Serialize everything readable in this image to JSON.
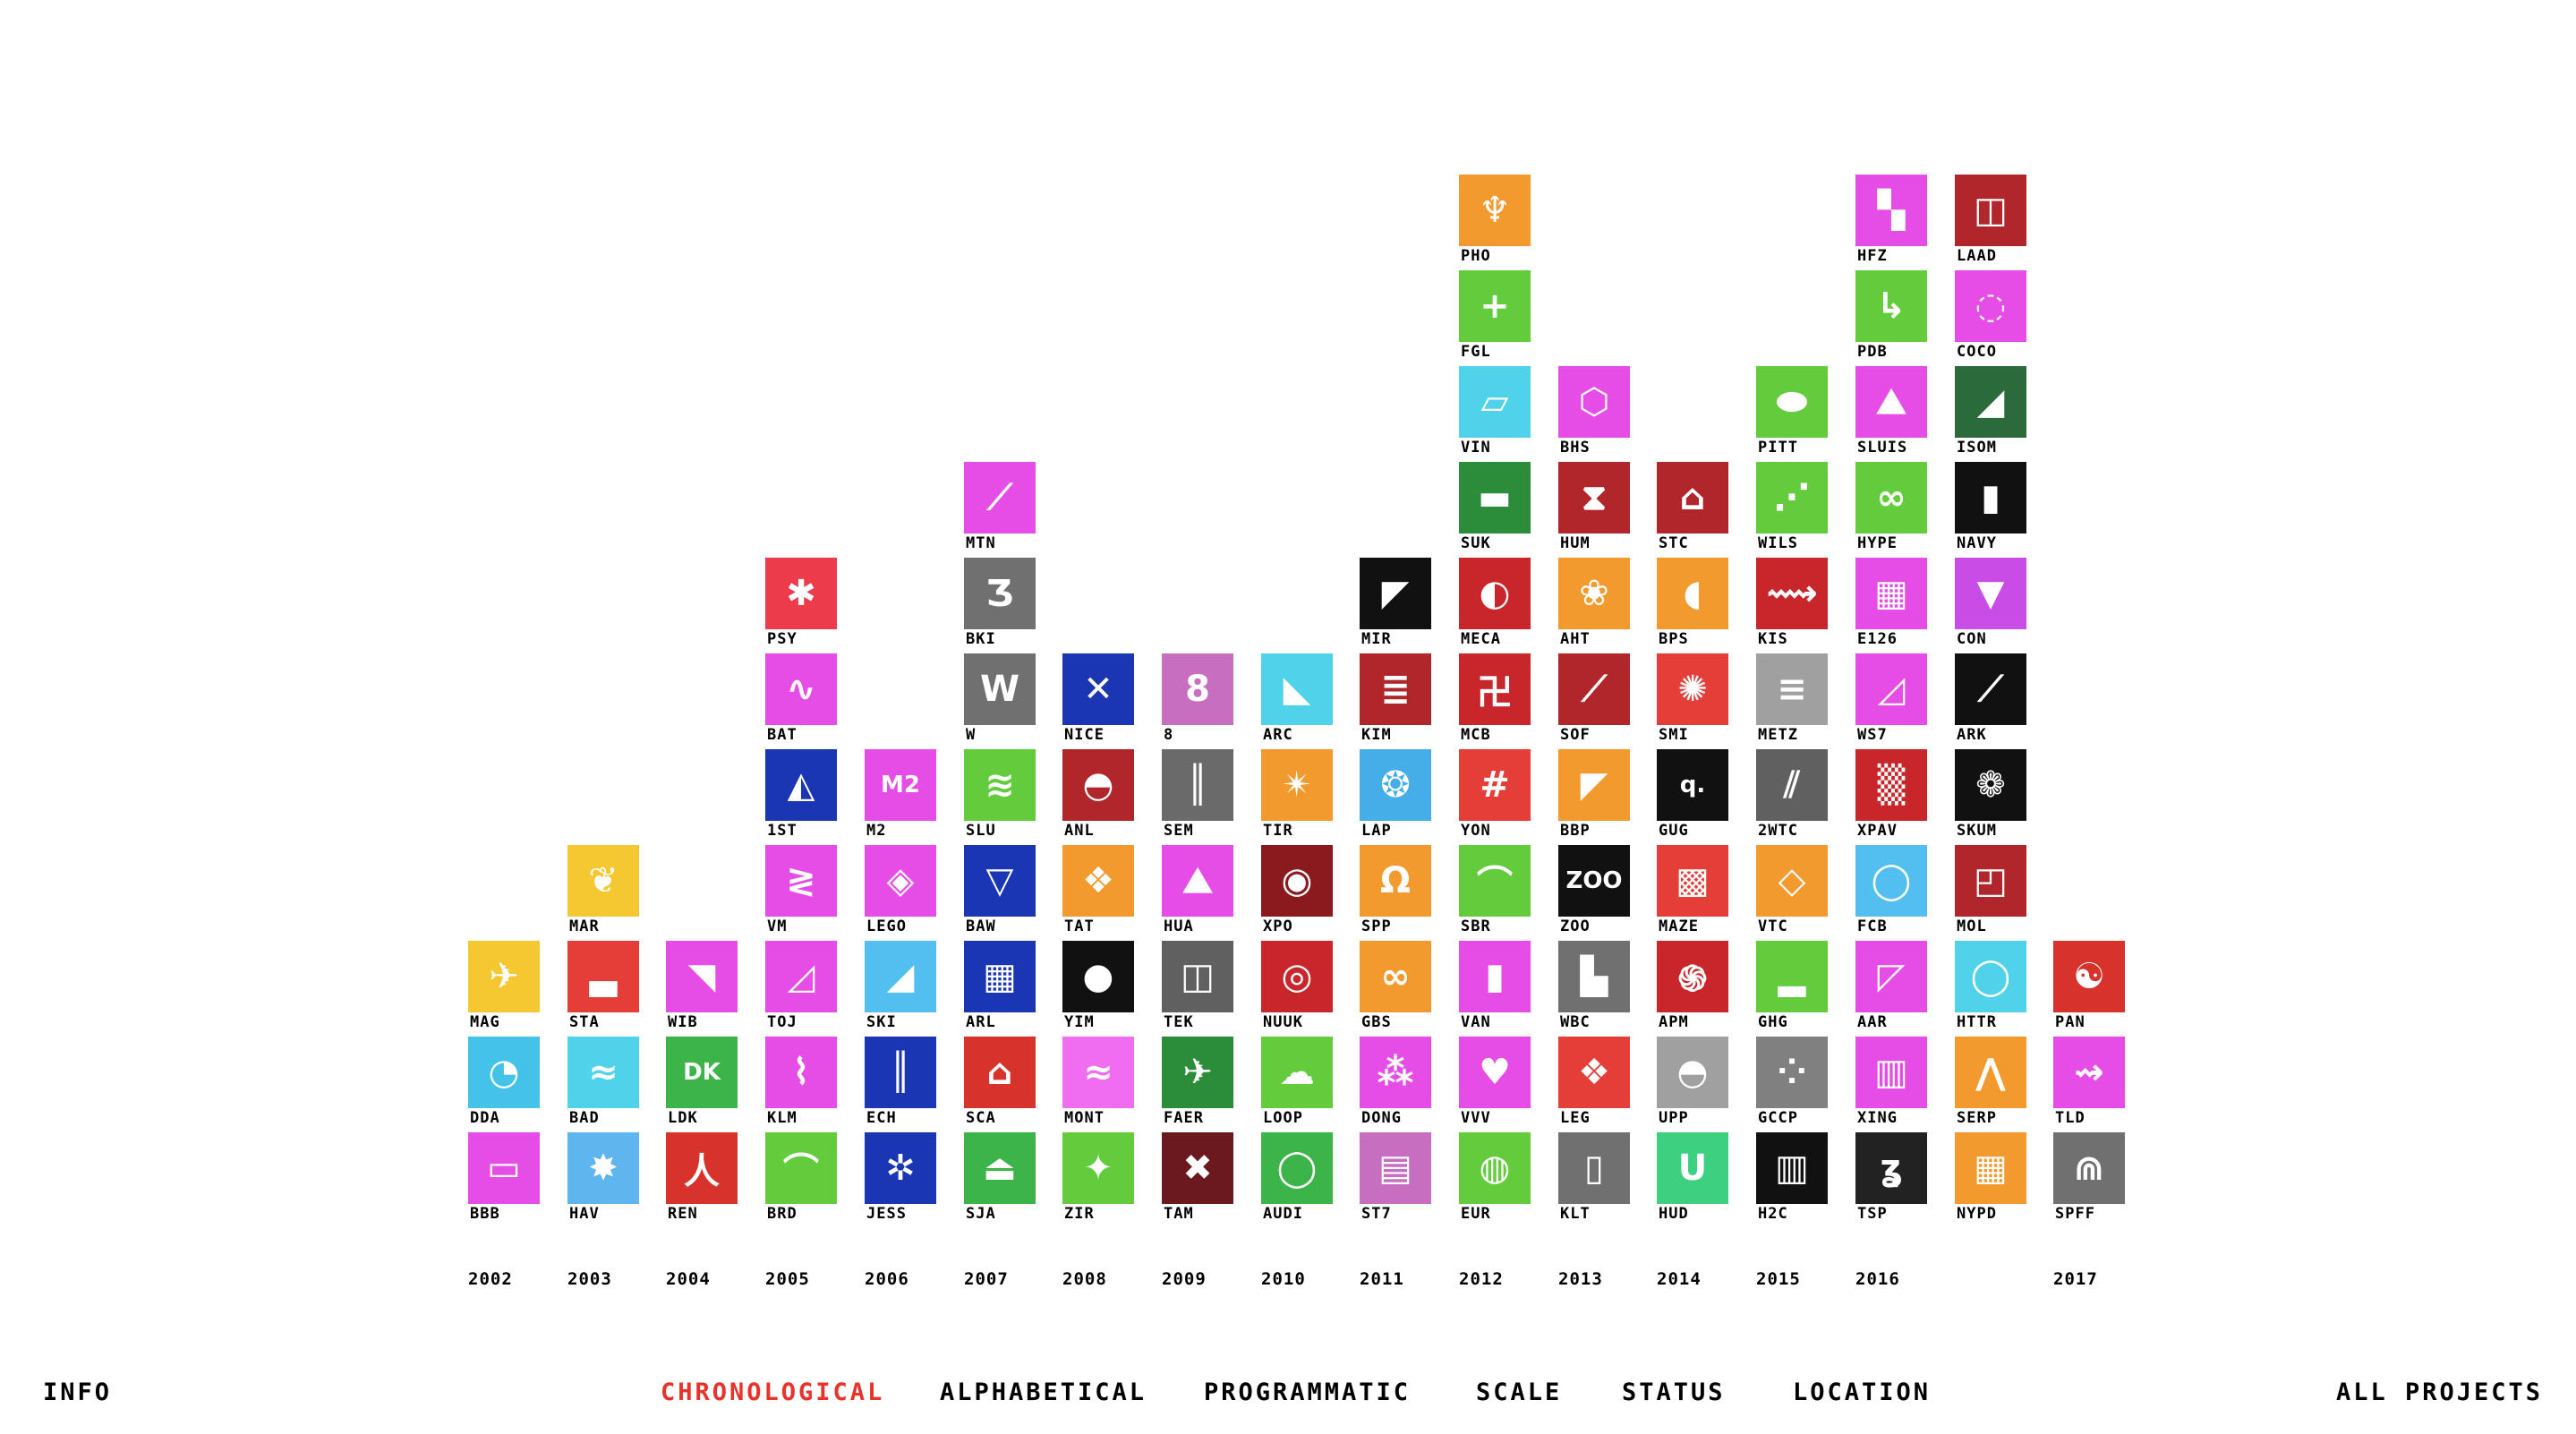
{
  "nav": {
    "info": "INFO",
    "all_projects": "ALL PROJECTS",
    "sorts": [
      {
        "label": "CHRONOLOGICAL",
        "active": true
      },
      {
        "label": "ALPHABETICAL",
        "active": false
      },
      {
        "label": "PROGRAMMATIC",
        "active": false
      },
      {
        "label": "SCALE",
        "active": false
      },
      {
        "label": "STATUS",
        "active": false
      },
      {
        "label": "LOCATION",
        "active": false
      }
    ],
    "active_color": "#e8322a"
  },
  "columns": [
    {
      "year": "2002",
      "projects": [
        {
          "code": "BBB",
          "color": "#e64ce6",
          "glyph": "▭"
        },
        {
          "code": "DDA",
          "color": "#45c2e8",
          "glyph": "◔"
        },
        {
          "code": "MAG",
          "color": "#f5c832",
          "glyph": "✈"
        }
      ]
    },
    {
      "year": "2003",
      "projects": [
        {
          "code": "HAV",
          "color": "#5fb6ee",
          "glyph": "✸"
        },
        {
          "code": "BAD",
          "color": "#4fd2ea",
          "glyph": "≈"
        },
        {
          "code": "STA",
          "color": "#e53e38",
          "glyph": "▃"
        },
        {
          "code": "MAR",
          "color": "#f5c832",
          "glyph": "❦"
        }
      ]
    },
    {
      "year": "2004",
      "projects": [
        {
          "code": "REN",
          "color": "#d8332b",
          "glyph": "人"
        },
        {
          "code": "LDK",
          "color": "#3cb44a",
          "glyph": "DK"
        },
        {
          "code": "WIB",
          "color": "#e64ce6",
          "glyph": "◥"
        }
      ]
    },
    {
      "year": "2005",
      "projects": [
        {
          "code": "BRD",
          "color": "#62cc3c",
          "glyph": "⌒"
        },
        {
          "code": "KLM",
          "color": "#e64ce6",
          "glyph": "⌇"
        },
        {
          "code": "TOJ",
          "color": "#e64ce6",
          "glyph": "◿"
        },
        {
          "code": "VM",
          "color": "#e64ce6",
          "glyph": "≷"
        },
        {
          "code": "1ST",
          "color": "#1b36b3",
          "glyph": "◭"
        },
        {
          "code": "BAT",
          "color": "#e64ce6",
          "glyph": "∿"
        },
        {
          "code": "PSY",
          "color": "#ec3c4c",
          "glyph": "✱"
        }
      ]
    },
    {
      "year": "2006",
      "projects": [
        {
          "code": "JESS",
          "color": "#1b36b3",
          "glyph": "✲"
        },
        {
          "code": "ECH",
          "color": "#1b36b3",
          "glyph": "║"
        },
        {
          "code": "SKI",
          "color": "#53bff0",
          "glyph": "◢"
        },
        {
          "code": "LEGO",
          "color": "#e64ce6",
          "glyph": "◈"
        },
        {
          "code": "M2",
          "color": "#e64ce6",
          "glyph": "M2"
        }
      ]
    },
    {
      "year": "2007",
      "projects": [
        {
          "code": "SJA",
          "color": "#3cb44a",
          "glyph": "⏏"
        },
        {
          "code": "SCA",
          "color": "#d8332b",
          "glyph": "⌂"
        },
        {
          "code": "ARL",
          "color": "#1b36b3",
          "glyph": "▦"
        },
        {
          "code": "BAW",
          "color": "#1b36b3",
          "glyph": "▽"
        },
        {
          "code": "SLU",
          "color": "#62cc3c",
          "glyph": "≋"
        },
        {
          "code": "W",
          "color": "#707070",
          "glyph": "W"
        },
        {
          "code": "BKI",
          "color": "#707070",
          "glyph": "Ʒ"
        },
        {
          "code": "MTN",
          "color": "#e64ce6",
          "glyph": "⟋"
        }
      ]
    },
    {
      "year": "2008",
      "projects": [
        {
          "code": "ZIR",
          "color": "#62cc3c",
          "glyph": "✦"
        },
        {
          "code": "MONT",
          "color": "#f06cf0",
          "glyph": "≈"
        },
        {
          "code": "YIM",
          "color": "#111111",
          "glyph": "●"
        },
        {
          "code": "TAT",
          "color": "#f39a2e",
          "glyph": "❖"
        },
        {
          "code": "ANL",
          "color": "#b0262a",
          "glyph": "◓"
        },
        {
          "code": "NICE",
          "color": "#1b36b3",
          "glyph": "✕"
        }
      ]
    },
    {
      "year": "2009",
      "projects": [
        {
          "code": "TAM",
          "color": "#6a1a1e",
          "glyph": "✖"
        },
        {
          "code": "FAER",
          "color": "#2b8c3a",
          "glyph": "✈"
        },
        {
          "code": "TEK",
          "color": "#606060",
          "glyph": "◫"
        },
        {
          "code": "HUA",
          "color": "#e64ce6",
          "glyph": "⛰"
        },
        {
          "code": "SEM",
          "color": "#6a6a6a",
          "glyph": "║"
        },
        {
          "code": "8",
          "color": "#c86ec0",
          "glyph": "8"
        }
      ]
    },
    {
      "year": "2010",
      "projects": [
        {
          "code": "AUDI",
          "color": "#3cb44a",
          "glyph": "◯"
        },
        {
          "code": "LOOP",
          "color": "#62cc3c",
          "glyph": "☁"
        },
        {
          "code": "NUUK",
          "color": "#c8262a",
          "glyph": "◎"
        },
        {
          "code": "XPO",
          "color": "#8a1a1e",
          "glyph": "◉"
        },
        {
          "code": "TIR",
          "color": "#f39a2e",
          "glyph": "✴"
        },
        {
          "code": "ARC",
          "color": "#4fd2ea",
          "glyph": "◣"
        }
      ]
    },
    {
      "year": "2011",
      "projects": [
        {
          "code": "ST7",
          "color": "#c86ec0",
          "glyph": "▤"
        },
        {
          "code": "DONG",
          "color": "#e64ce6",
          "glyph": "⁂"
        },
        {
          "code": "GBS",
          "color": "#f39a2e",
          "glyph": "∞"
        },
        {
          "code": "SPP",
          "color": "#f39a2e",
          "glyph": "Ω"
        },
        {
          "code": "LAP",
          "color": "#45aee8",
          "glyph": "❂"
        },
        {
          "code": "KIM",
          "color": "#b0262a",
          "glyph": "≣"
        },
        {
          "code": "MIR",
          "color": "#111111",
          "glyph": "◤"
        }
      ]
    },
    {
      "year": "2012",
      "projects": [
        {
          "code": "EUR",
          "color": "#62cc3c",
          "glyph": "◍"
        },
        {
          "code": "VVV",
          "color": "#e64ce6",
          "glyph": "♥"
        },
        {
          "code": "VAN",
          "color": "#e64ce6",
          "glyph": "▮"
        },
        {
          "code": "SBR",
          "color": "#62cc3c",
          "glyph": "⌒"
        },
        {
          "code": "YON",
          "color": "#e53e38",
          "glyph": "#"
        },
        {
          "code": "MCB",
          "color": "#c8262a",
          "glyph": "卍"
        },
        {
          "code": "MECA",
          "color": "#c8262a",
          "glyph": "◐"
        },
        {
          "code": "SUK",
          "color": "#2b8c3a",
          "glyph": "▬"
        },
        {
          "code": "VIN",
          "color": "#4fd2ea",
          "glyph": "▱"
        },
        {
          "code": "FGL",
          "color": "#62cc3c",
          "glyph": "+"
        },
        {
          "code": "PHO",
          "color": "#f39a2e",
          "glyph": "♆"
        }
      ]
    },
    {
      "year": "2013",
      "projects": [
        {
          "code": "KLT",
          "color": "#707070",
          "glyph": "▯"
        },
        {
          "code": "LEG",
          "color": "#e53e38",
          "glyph": "❖"
        },
        {
          "code": "WBC",
          "color": "#707070",
          "glyph": "▙"
        },
        {
          "code": "ZOO",
          "color": "#111111",
          "glyph": "ZOO"
        },
        {
          "code": "BBP",
          "color": "#f39a2e",
          "glyph": "◤"
        },
        {
          "code": "SOF",
          "color": "#b0262a",
          "glyph": "⟋"
        },
        {
          "code": "AHT",
          "color": "#f39a2e",
          "glyph": "❀"
        },
        {
          "code": "HUM",
          "color": "#b0262a",
          "glyph": "⧗"
        },
        {
          "code": "BHS",
          "color": "#e64ce6",
          "glyph": "⬡"
        }
      ]
    },
    {
      "year": "2014",
      "projects": [
        {
          "code": "HUD",
          "color": "#3cd080",
          "glyph": "U"
        },
        {
          "code": "UPP",
          "color": "#a0a0a0",
          "glyph": "◓"
        },
        {
          "code": "APM",
          "color": "#c8262a",
          "glyph": "֍"
        },
        {
          "code": "MAZE",
          "color": "#e53e38",
          "glyph": "▩"
        },
        {
          "code": "GUG",
          "color": "#111111",
          "glyph": "q."
        },
        {
          "code": "SMI",
          "color": "#e53e38",
          "glyph": "✺"
        },
        {
          "code": "BPS",
          "color": "#f39a2e",
          "glyph": "◖"
        },
        {
          "code": "STC",
          "color": "#b0262a",
          "glyph": "⌂"
        }
      ]
    },
    {
      "year": "2015",
      "projects": [
        {
          "code": "H2C",
          "color": "#111111",
          "glyph": "▥"
        },
        {
          "code": "GCCP",
          "color": "#808080",
          "glyph": "⁘"
        },
        {
          "code": "GHG",
          "color": "#62cc3c",
          "glyph": "▂"
        },
        {
          "code": "VTC",
          "color": "#f39a2e",
          "glyph": "◇"
        },
        {
          "code": "2WTC",
          "color": "#606060",
          "glyph": "⫽"
        },
        {
          "code": "METZ",
          "color": "#a0a0a0",
          "glyph": "≡"
        },
        {
          "code": "KIS",
          "color": "#c8262a",
          "glyph": "⟿"
        },
        {
          "code": "WILS",
          "color": "#62cc3c",
          "glyph": "⋰"
        },
        {
          "code": "PITT",
          "color": "#62cc3c",
          "glyph": "⬬"
        }
      ]
    },
    {
      "year": "2016",
      "projects": [
        {
          "code": "TSP",
          "color": "#222222",
          "glyph": "ʓ"
        },
        {
          "code": "XING",
          "color": "#e64ce6",
          "glyph": "▥"
        },
        {
          "code": "AAR",
          "color": "#e64ce6",
          "glyph": "◸"
        },
        {
          "code": "FCB",
          "color": "#53bff0",
          "glyph": "◯"
        },
        {
          "code": "XPAV",
          "color": "#c8262a",
          "glyph": "▒"
        },
        {
          "code": "WS7",
          "color": "#e64ce6",
          "glyph": "◿"
        },
        {
          "code": "E126",
          "color": "#e64ce6",
          "glyph": "▦"
        },
        {
          "code": "HYPE",
          "color": "#62cc3c",
          "glyph": "∞"
        },
        {
          "code": "SLUIS",
          "color": "#e64ce6",
          "glyph": "⛰"
        },
        {
          "code": "PDB",
          "color": "#62cc3c",
          "glyph": "↳"
        },
        {
          "code": "HFZ",
          "color": "#e64ce6",
          "glyph": "▚"
        }
      ]
    },
    {
      "year": "",
      "projects": [
        {
          "code": "NYPD",
          "color": "#f39a2e",
          "glyph": "▦"
        },
        {
          "code": "SERP",
          "color": "#f39a2e",
          "glyph": "⋀"
        },
        {
          "code": "HTTR",
          "color": "#4fd2ea",
          "glyph": "◯"
        },
        {
          "code": "MOL",
          "color": "#b0262a",
          "glyph": "◰"
        },
        {
          "code": "SKUM",
          "color": "#111111",
          "glyph": "❁"
        },
        {
          "code": "ARK",
          "color": "#111111",
          "glyph": "⟋"
        },
        {
          "code": "CON",
          "color": "#c84ce6",
          "glyph": "▼"
        },
        {
          "code": "NAVY",
          "color": "#111111",
          "glyph": "▮"
        },
        {
          "code": "ISOM",
          "color": "#2b6a3a",
          "glyph": "◢"
        },
        {
          "code": "COCO",
          "color": "#e64ce6",
          "glyph": "◌"
        },
        {
          "code": "LAAD",
          "color": "#b0262a",
          "glyph": "◫"
        }
      ]
    },
    {
      "year": "2017",
      "projects": [
        {
          "code": "SPFF",
          "color": "#707070",
          "glyph": "⋒"
        },
        {
          "code": "TLD",
          "color": "#e64ce6",
          "glyph": "⇝"
        },
        {
          "code": "PAN",
          "color": "#d8332b",
          "glyph": "☯"
        }
      ]
    }
  ]
}
